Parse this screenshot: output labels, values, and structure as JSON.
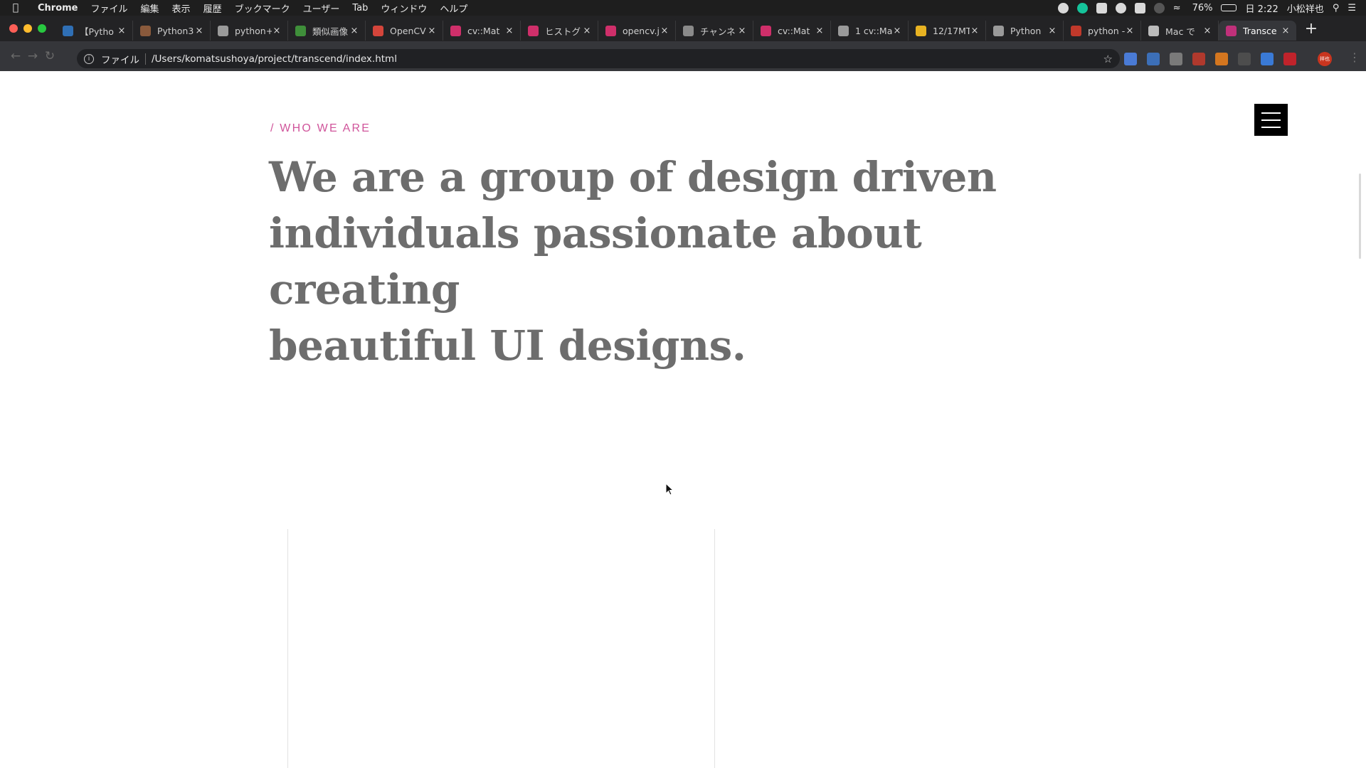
{
  "menubar": {
    "app": "Chrome",
    "items": [
      "ファイル",
      "編集",
      "表示",
      "履歴",
      "ブックマーク",
      "ユーザー",
      "Tab",
      "ウィンドウ",
      "ヘルプ"
    ],
    "battery": "76%",
    "clock": "日 2:22",
    "user": "小松祥也"
  },
  "tabs": [
    {
      "title": "【Pytho",
      "color": "#2f6fb5"
    },
    {
      "title": "Python3",
      "color": "#8a5a3c"
    },
    {
      "title": "python+",
      "color": "#9a9a9a"
    },
    {
      "title": "類似画像",
      "color": "#3f8f3a"
    },
    {
      "title": "OpenCV",
      "color": "#d4453b"
    },
    {
      "title": "cv::Mat",
      "color": "#cf2f6a"
    },
    {
      "title": "ヒストグ",
      "color": "#cf2f6a"
    },
    {
      "title": "opencv.j",
      "color": "#cf2f6a"
    },
    {
      "title": "チャンネ",
      "color": "#8a8a8a"
    },
    {
      "title": "cv::Mat",
      "color": "#cf2f6a"
    },
    {
      "title": "1 cv::Ma",
      "color": "#9a9a9a"
    },
    {
      "title": "12/17MT",
      "color": "#e8b322"
    },
    {
      "title": "Python",
      "color": "#9a9a9a"
    },
    {
      "title": "python -",
      "color": "#c0392b"
    },
    {
      "title": "Mac で",
      "color": "#bbbbbb"
    },
    {
      "title": "Transce",
      "color": "#c0307a",
      "active": true
    }
  ],
  "omnibox": {
    "scheme_label": "ファイル",
    "url": "/Users/komatsushoya/project/transcend/index.html"
  },
  "extensions": [
    "#4a7bd6",
    "#3c6fb8",
    "#7a7a7a",
    "#b0392d",
    "#d4761f",
    "#4d4d4d",
    "#3a7ad6",
    "#c0232b"
  ],
  "profile_label": "祥也",
  "page": {
    "eyebrow": "/ WHO WE ARE",
    "headline_lines": [
      "We are a group of design driven",
      "individuals passionate about creating",
      "beautiful UI designs."
    ],
    "accent_color": "#d0559b"
  }
}
